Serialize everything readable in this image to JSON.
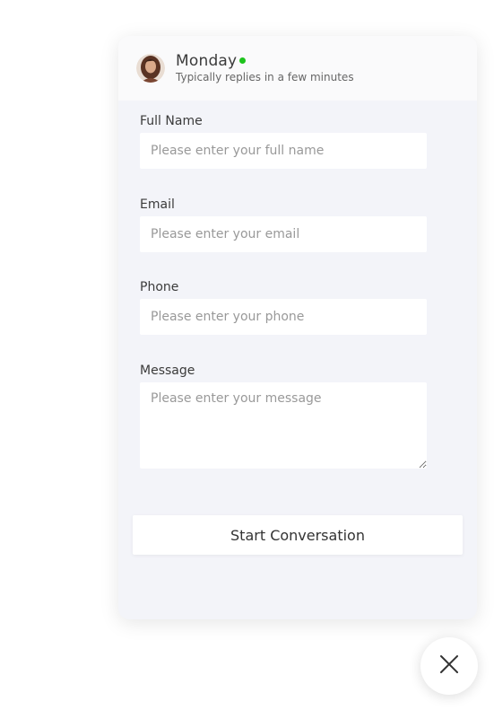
{
  "header": {
    "agent_name": "Monday",
    "status_text": "Typically replies in a few minutes",
    "online_color": "#1dc31d"
  },
  "form": {
    "full_name": {
      "label": "Full Name",
      "placeholder": "Please enter your full name",
      "value": ""
    },
    "email": {
      "label": "Email",
      "placeholder": "Please enter your email",
      "value": ""
    },
    "phone": {
      "label": "Phone",
      "placeholder": "Please enter your phone",
      "value": ""
    },
    "message": {
      "label": "Message",
      "placeholder": "Please enter your message",
      "value": ""
    },
    "submit_label": "Start Conversation"
  },
  "icons": {
    "avatar": "agent-avatar",
    "close": "close-icon"
  }
}
